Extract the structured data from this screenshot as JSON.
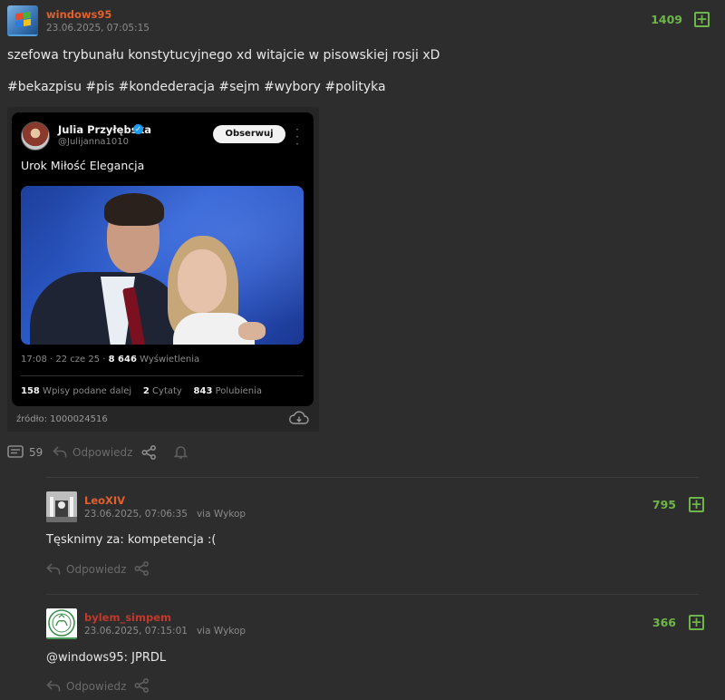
{
  "post": {
    "author": "windows95",
    "timestamp": "23.06.2025, 07:05:15",
    "votes": "1409",
    "text": "szefowa trybunału konstytucyjnego xd witajcie w pisowskiej rosji xD",
    "tags": "#bekazpisu #pis #kondederacja #sejm #wybory #polityka",
    "source_label": "źródło: 1000024516",
    "comment_count": "59",
    "reply_label": "Odpowiedz"
  },
  "tweet": {
    "name": "Julia Przyłębska",
    "handle": "@Julijanna1010",
    "follow_label": "Obserwuj",
    "text": "Urok Miłość Elegancja",
    "meta_time": "17:08 · 22 cze 25 · ",
    "views": "8 646",
    "views_label": " Wyświetlenia",
    "retweets": "158",
    "retweets_label": " Wpisy podane dalej",
    "quotes": "2",
    "quotes_label": " Cytaty",
    "likes": "843",
    "likes_label": " Polubienia"
  },
  "comments": [
    {
      "author": "LeoXIV",
      "timestamp": "23.06.2025, 07:06:35",
      "via": "via Wykop",
      "votes": "795",
      "text": "Tęsknimy za: kompetencja :(",
      "reply_label": "Odpowiedz"
    },
    {
      "author": "bylem_simpem",
      "timestamp": "23.06.2025, 07:15:01",
      "via": "via Wykop",
      "votes": "366",
      "text": "@windows95: JPRDL",
      "reply_label": "Odpowiedz"
    }
  ],
  "colors": {
    "background": "#2d2d2d",
    "username_orange": "#e2602c",
    "username_red": "#c0392b",
    "vote_green": "#6fb64a"
  },
  "icons": [
    "windows-logo-avatar",
    "plus-icon",
    "verified-badge-icon",
    "more-options-icon",
    "cloud-download-icon",
    "comments-icon",
    "reply-icon",
    "share-icon",
    "notification-bell-icon"
  ]
}
